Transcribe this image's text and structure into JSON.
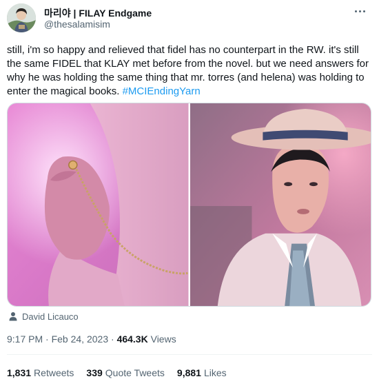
{
  "author": {
    "display_name": "마리야 | FILAY Endgame",
    "handle": "@thesalamisim"
  },
  "tweet": {
    "text_parts": [
      "still, i'm so happy and relieved that fidel has no counterpart in the RW. it's still the same FIDEL that KLAY met before from the novel. but we need answers for why he was holding the same thing that mr. torres (and helena) was holding to enter the magical books. "
    ],
    "hashtag": "#MCIEndingYarn"
  },
  "media": {
    "photos": [
      "hand-holding-pocket-watch-chain",
      "man-in-straw-boater-hat"
    ],
    "credit_icon": "person-icon",
    "credit": "David Licauco"
  },
  "meta": {
    "time": "9:17 PM",
    "sep1": " · ",
    "date": "Feb 24, 2023",
    "sep2": " · ",
    "views_count": "464.3K",
    "views_label": " Views"
  },
  "stats": {
    "retweets_count": "1,831",
    "retweets_label": "Retweets",
    "quotes_count": "339",
    "quotes_label": "Quote Tweets",
    "likes_count": "9,881",
    "likes_label": "Likes"
  },
  "colors": {
    "text": "#0f1419",
    "secondary": "#536471",
    "link": "#1d9bf0",
    "divider": "#eff3f4"
  }
}
